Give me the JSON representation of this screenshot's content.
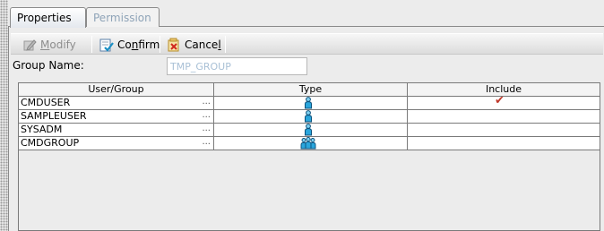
{
  "tabs": [
    {
      "label": "Properties",
      "active": true
    },
    {
      "label": "Permission",
      "active": false
    }
  ],
  "toolbar": {
    "modify": {
      "pre": "",
      "mnemonic": "M",
      "post": "odify",
      "enabled": false,
      "icon": "edit-icon"
    },
    "confirm": {
      "pre": "Co",
      "mnemonic": "n",
      "post": "firm",
      "enabled": true,
      "icon": "confirm-icon"
    },
    "cancel": {
      "pre": "Cance",
      "mnemonic": "l",
      "post": "",
      "enabled": true,
      "icon": "cancel-icon"
    }
  },
  "group": {
    "label": "Group Name:",
    "value": "TMP_GROUP"
  },
  "table": {
    "columns": [
      "User/Group",
      "Type",
      "Include"
    ],
    "rows": [
      {
        "name": "CMDUSER",
        "ellipsis": "...",
        "type": "user",
        "include": true
      },
      {
        "name": "SAMPLEUSER",
        "ellipsis": "...",
        "type": "user",
        "include": false
      },
      {
        "name": "SYSADM",
        "ellipsis": "...",
        "type": "user",
        "include": false
      },
      {
        "name": "CMDGROUP",
        "ellipsis": "...",
        "type": "group",
        "include": false
      }
    ]
  },
  "colors": {
    "accent": "#1a8fc4",
    "check": "#c0392b",
    "disabled_text": "#8fa4b8"
  }
}
